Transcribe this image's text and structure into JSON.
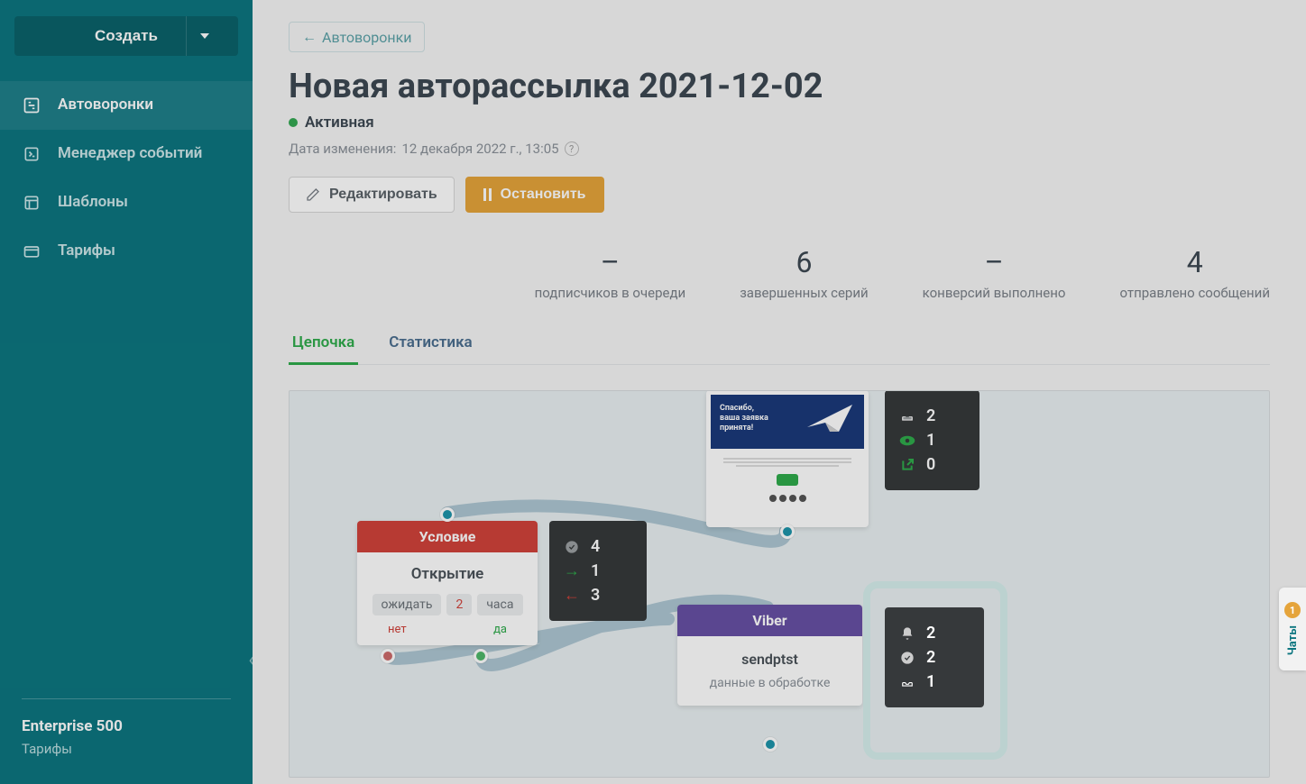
{
  "sidebar": {
    "create": "Создать",
    "items": [
      {
        "label": "Автоворонки"
      },
      {
        "label": "Менеджер событий"
      },
      {
        "label": "Шаблоны"
      },
      {
        "label": "Тарифы"
      }
    ],
    "plan": "Enterprise 500",
    "plan_link": "Тарифы"
  },
  "header": {
    "back": "Автоворонки",
    "title": "Новая авторассылка 2021-12-02",
    "status": "Активная",
    "date_prefix": "Дата изменения:",
    "date": "12 декабря 2022 г., 13:05",
    "edit": "Редактировать",
    "stop": "Остановить"
  },
  "stats": [
    {
      "value": "–",
      "label": "подписчиков в очереди"
    },
    {
      "value": "6",
      "label": "завершенных серий"
    },
    {
      "value": "–",
      "label": "конверсий выполнено"
    },
    {
      "value": "4",
      "label": "отправлено сообщений"
    }
  ],
  "tabs": {
    "chain": "Цепочка",
    "stats": "Статистика"
  },
  "flow": {
    "email": {
      "thanks_l1": "Спасибо,",
      "thanks_l2": "ваша заявка",
      "thanks_l3": "принята!"
    },
    "email_metrics": {
      "sent": "2",
      "opened": "1",
      "clicked": "0"
    },
    "condition": {
      "header": "Условие",
      "title": "Открытие",
      "wait": "ожидать",
      "num": "2",
      "unit": "часа",
      "no": "нет",
      "yes": "да"
    },
    "cond_metrics": {
      "checked": "4",
      "yes": "1",
      "no": "3"
    },
    "viber": {
      "header": "Viber",
      "title": "sendptst",
      "sub": "данные в обработке"
    },
    "viber_metrics": {
      "sent": "2",
      "delivered": "2",
      "read": "1"
    }
  },
  "chat": {
    "label": "Чаты",
    "badge": "1"
  }
}
